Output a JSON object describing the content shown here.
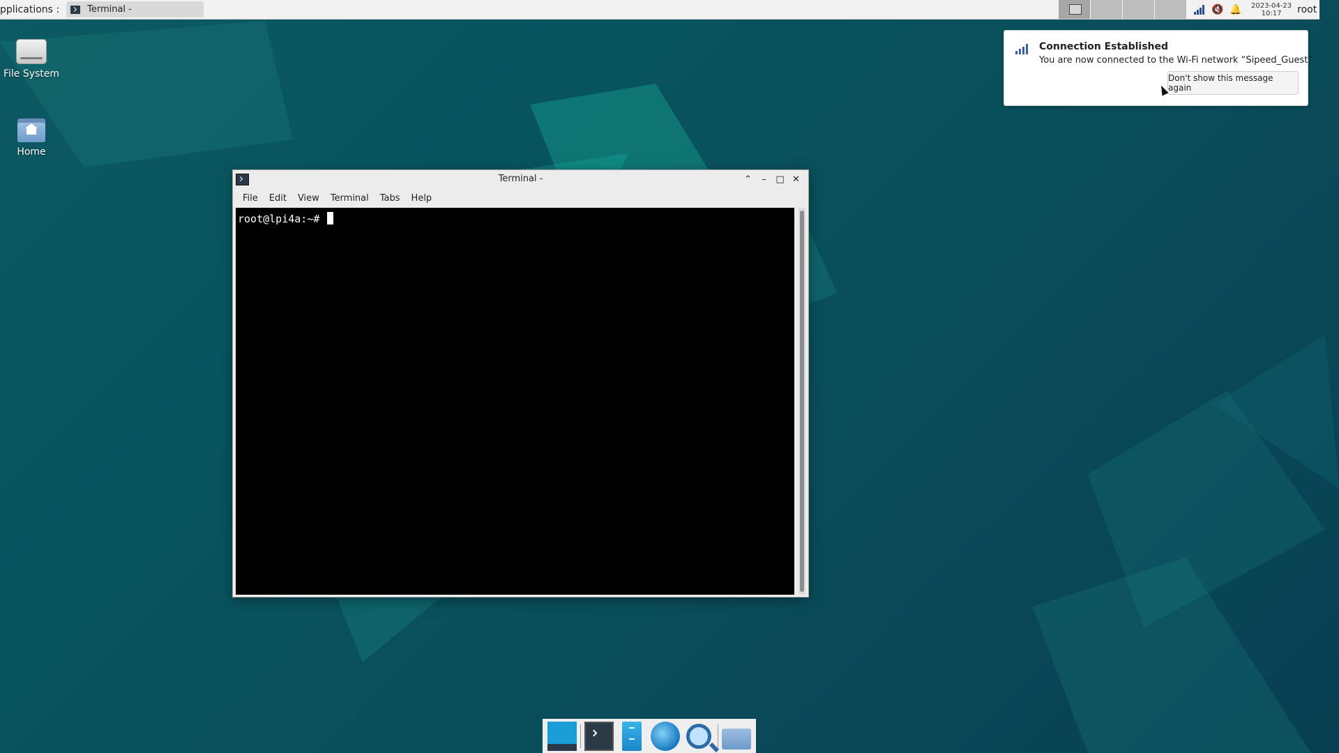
{
  "top_panel": {
    "apps_menu": "pplications :",
    "task_button": "Terminal -",
    "clock_date": "2023-04-23",
    "clock_time": "10:17",
    "user": "root",
    "tray_icons": [
      "network-icon",
      "volume-muted-icon",
      "bell-icon"
    ]
  },
  "desktop": {
    "icons": [
      {
        "label": "File System",
        "icon": "drive-icon"
      },
      {
        "label": "Home",
        "icon": "home-folder-icon"
      }
    ]
  },
  "terminal_window": {
    "title": "Terminal -",
    "menu": [
      "File",
      "Edit",
      "View",
      "Terminal",
      "Tabs",
      "Help"
    ],
    "prompt": "root@lpi4a:~#"
  },
  "notification": {
    "title": "Connection Established",
    "body": "You are now connected to the Wi-Fi network “Sipeed_Guest”.",
    "button": "Don't show this message again"
  },
  "dock": {
    "items": [
      "show-desktop-icon",
      "terminal-icon",
      "file-manager-icon",
      "web-browser-icon",
      "app-finder-icon",
      "folder-icon"
    ]
  },
  "colors": {
    "desktop_bg": "#07545f",
    "panel_bg": "#f2f2f2",
    "terminal_bg": "#000000"
  }
}
